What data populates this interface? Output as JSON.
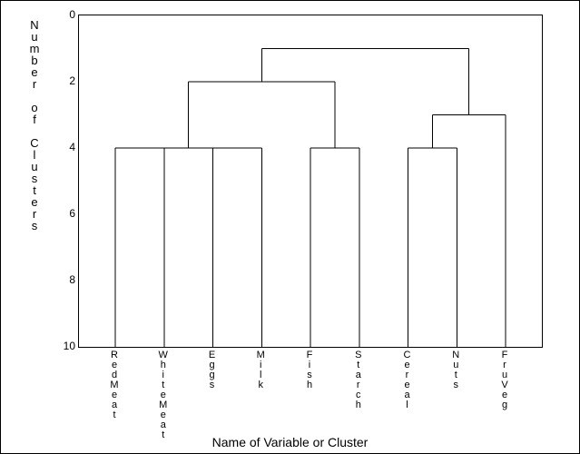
{
  "chart_data": {
    "type": "dendrogram",
    "xlabel": "Name of Variable or Cluster",
    "ylabel": "Number of Clusters",
    "ylim": [
      10,
      0
    ],
    "y_ticks": [
      0,
      2,
      4,
      6,
      8,
      10
    ],
    "leaves": [
      "RedMeat",
      "WhiteMeat",
      "Eggs",
      "Milk",
      "Fish",
      "Starch",
      "Cereal",
      "Nuts",
      "FruVeg"
    ],
    "merges": [
      {
        "left": {
          "leaf": 0
        },
        "right": {
          "leaf": 1
        },
        "height": 4,
        "id": "m0"
      },
      {
        "left": {
          "leaf": 2
        },
        "right": {
          "leaf": 3
        },
        "height": 4,
        "id": "m1"
      },
      {
        "left": {
          "leaf": 4
        },
        "right": {
          "leaf": 5
        },
        "height": 4,
        "id": "m2"
      },
      {
        "left": {
          "leaf": 6
        },
        "right": {
          "leaf": 7
        },
        "height": 4,
        "id": "m3"
      },
      {
        "left": {
          "merge": "m0"
        },
        "right": {
          "merge": "m1"
        },
        "height": 4,
        "id": "m4"
      },
      {
        "left": {
          "merge": "m3"
        },
        "right": {
          "leaf": 8
        },
        "height": 3,
        "id": "m5"
      },
      {
        "left": {
          "merge": "m4"
        },
        "right": {
          "merge": "m2"
        },
        "height": 2,
        "id": "m6"
      },
      {
        "left": {
          "merge": "m6"
        },
        "right": {
          "merge": "m5"
        },
        "height": 1,
        "id": "m7"
      }
    ]
  }
}
